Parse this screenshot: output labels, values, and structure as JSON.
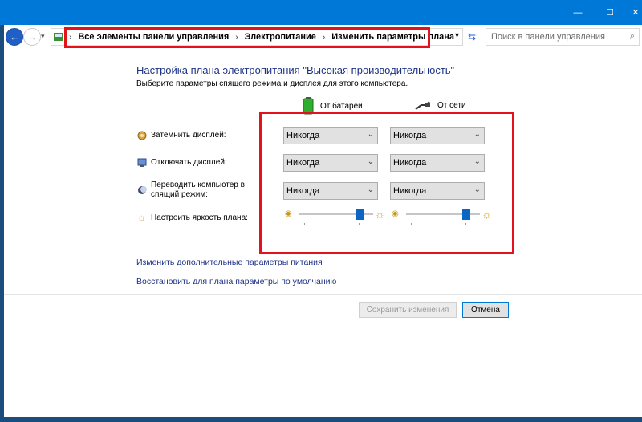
{
  "address": {
    "crumbs": [
      "Все элементы панели управления",
      "Электропитание",
      "Изменить параметры плана"
    ],
    "search_placeholder": "Поиск в панели управления"
  },
  "page": {
    "heading": "Настройка плана электропитания \"Высокая производительность\"",
    "subheading": "Выберите параметры спящего режима и дисплея для этого компьютера.",
    "col_battery": "От батареи",
    "col_plugged": "От сети"
  },
  "settings": [
    {
      "label": "Затемнить дисплей:",
      "battery": "Никогда",
      "plugged": "Никогда"
    },
    {
      "label": "Отключать дисплей:",
      "battery": "Никогда",
      "plugged": "Никогда"
    },
    {
      "label": "Переводить компьютер в спящий режим:",
      "battery": "Никогда",
      "plugged": "Никогда"
    }
  ],
  "brightness": {
    "label": "Настроить яркость плана:",
    "battery_level": 0.82,
    "plugged_level": 0.82
  },
  "links": {
    "advanced": "Изменить дополнительные параметры питания",
    "restore": "Восстановить для плана параметры по умолчанию"
  },
  "buttons": {
    "save": "Сохранить изменения",
    "cancel": "Отмена"
  },
  "colors": {
    "accent": "#0078d7",
    "link": "#1e3287",
    "highlight_border": "#e2131a"
  }
}
